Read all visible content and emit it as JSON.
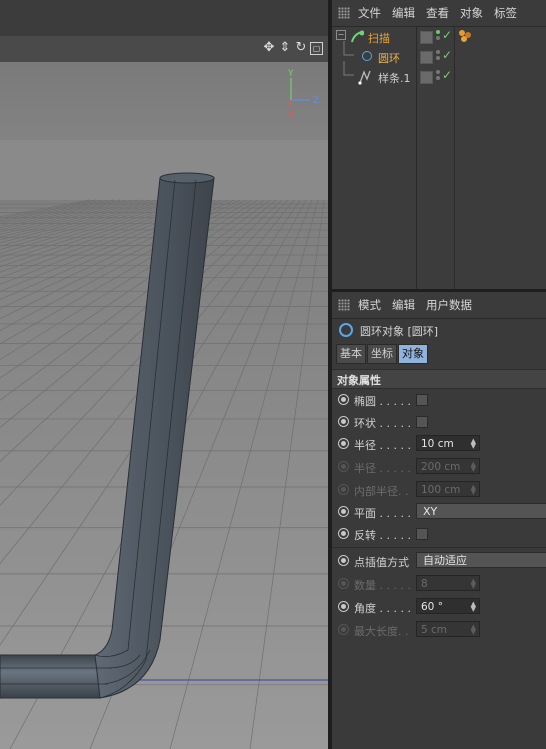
{
  "object_manager": {
    "menu": [
      "文件",
      "编辑",
      "查看",
      "对象",
      "标签"
    ],
    "objects": [
      {
        "name": "扫描",
        "color": "#e8a234",
        "icon": "sweep-icon"
      },
      {
        "name": "圆环",
        "color": "#e8b54a",
        "icon": "circle-icon"
      },
      {
        "name": "样条.1",
        "color": "#cfcfcf",
        "icon": "spline-icon"
      }
    ]
  },
  "attribute_manager": {
    "menu": [
      "模式",
      "编辑",
      "用户数据"
    ],
    "title": "圆环对象 [圆环]",
    "tabs": [
      {
        "label": "基本",
        "active": false
      },
      {
        "label": "坐标",
        "active": false
      },
      {
        "label": "对象",
        "active": true
      }
    ],
    "section": "对象属性",
    "properties": {
      "ellipse": {
        "label": "椭圆 . . . . .",
        "checked": false
      },
      "ring": {
        "label": "环状 . . . . .",
        "checked": false
      },
      "radius": {
        "label": "半径 . . . . .",
        "value": "10 cm"
      },
      "radius2": {
        "label": "半径 . . . . .",
        "value": "200 cm"
      },
      "inner_radius": {
        "label": "内部半径. .",
        "value": "100 cm"
      },
      "plane": {
        "label": "平面 . . . . .",
        "value": "XY"
      },
      "reverse": {
        "label": "反转 . . . . .",
        "checked": false
      },
      "interpolation": {
        "label": "点插值方式",
        "value": "自动适应"
      },
      "number": {
        "label": "数量 . . . . .",
        "value": "8"
      },
      "angle": {
        "label": "角度 . . . . .",
        "value": "60 °"
      },
      "max_length": {
        "label": "最大长度. .",
        "value": "5 cm"
      }
    }
  },
  "viewport": {
    "axes": {
      "y": "Y",
      "z": "Z",
      "x": "X"
    }
  }
}
